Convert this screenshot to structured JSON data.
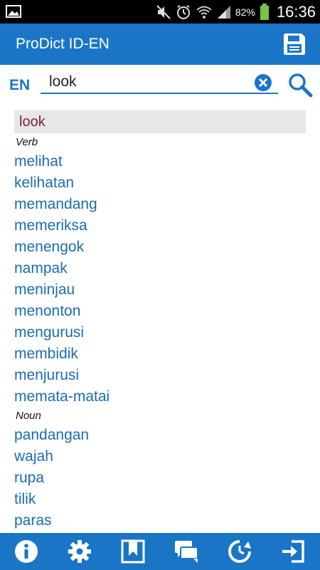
{
  "status_bar": {
    "battery_percent": "82%",
    "time": "16:36",
    "icons": [
      "gallery-icon",
      "mute-icon",
      "alarm-icon",
      "wifi-icon",
      "signal-icon",
      "battery-icon"
    ]
  },
  "action_bar": {
    "title": "ProDict ID-EN",
    "save_icon": "save-icon"
  },
  "search": {
    "language": "EN",
    "value": "look",
    "clear_icon": "clear-icon",
    "search_icon": "search-icon"
  },
  "results": {
    "headword": "look",
    "groups": [
      {
        "pos": "Verb",
        "translations": [
          "melihat",
          "kelihatan",
          "memandang",
          "memeriksa",
          "menengok",
          "nampak",
          "meninjau",
          "menonton",
          "mengurusi",
          "membidik",
          "menjurusi",
          "memata-matai"
        ]
      },
      {
        "pos": "Noun",
        "translations": [
          "pandangan",
          "wajah",
          "rupa",
          "tilik",
          "paras"
        ]
      }
    ]
  },
  "bottom_bar": {
    "buttons": [
      "info-icon",
      "settings-icon",
      "bookmarks-icon",
      "chat-icon",
      "history-icon",
      "exit-icon"
    ]
  },
  "colors": {
    "accent": "#1b75c6",
    "headword": "#7a1f45",
    "translation": "#1b6cb2",
    "highlight_bg": "#e7e7e7"
  }
}
